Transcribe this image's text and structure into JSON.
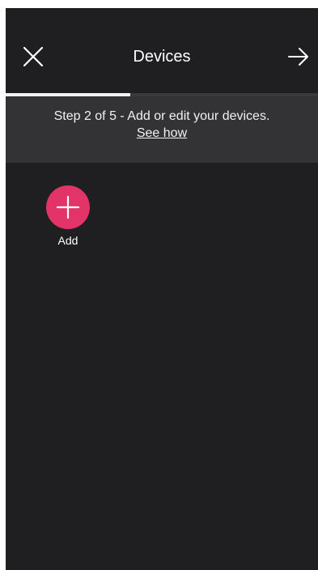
{
  "header": {
    "title": "Devices",
    "close_icon": "close-icon",
    "next_icon": "arrow-right-icon"
  },
  "progress": {
    "step": 2,
    "total": 5,
    "fraction": 0.4
  },
  "banner": {
    "text": "Step 2 of 5 - Add or edit your devices.",
    "link": "See how"
  },
  "devices": {
    "add_label": "Add",
    "add_icon": "plus-icon"
  },
  "colors": {
    "background": "#1f1e20",
    "banner": "#333234",
    "accent": "#e23468",
    "progress": "#f2f2f2",
    "text": "#ffffff"
  }
}
